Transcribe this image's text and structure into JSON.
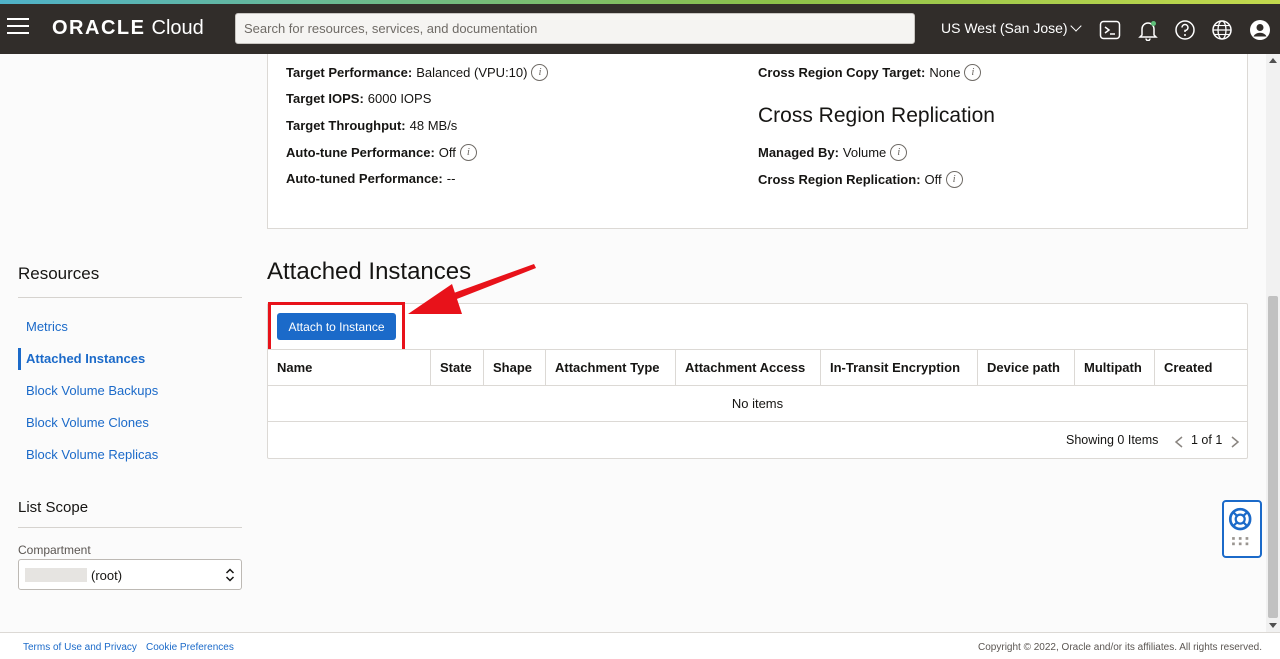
{
  "header": {
    "logo_brand": "ORACLE",
    "logo_product": "Cloud",
    "search_placeholder": "Search for resources, services, and documentation",
    "region": "US West (San Jose)",
    "icons": [
      "menu-icon",
      "cloud-shell-icon",
      "notifications-icon",
      "help-icon",
      "language-icon",
      "profile-icon"
    ]
  },
  "details": {
    "left": [
      {
        "label": "Target Performance:",
        "value": "Balanced (VPU:10)",
        "info": true
      },
      {
        "label": "Target IOPS:",
        "value": "6000 IOPS",
        "info": false
      },
      {
        "label": "Target Throughput:",
        "value": "48 MB/s",
        "info": false
      },
      {
        "label": "Auto-tune Performance:",
        "value": "Off",
        "info": true
      },
      {
        "label": "Auto-tuned Performance:",
        "value": "--",
        "info": false
      }
    ],
    "copy_target": {
      "label": "Cross Region Copy Target:",
      "value": "None"
    },
    "replication_title": "Cross Region Replication",
    "managed_by": {
      "label": "Managed By:",
      "value": "Volume"
    },
    "replication": {
      "label": "Cross Region Replication:",
      "value": "Off"
    }
  },
  "sidebar": {
    "resources_title": "Resources",
    "items": [
      {
        "label": "Metrics",
        "active": false
      },
      {
        "label": "Attached Instances",
        "active": true
      },
      {
        "label": "Block Volume Backups",
        "active": false
      },
      {
        "label": "Block Volume Clones",
        "active": false
      },
      {
        "label": "Block Volume Replicas",
        "active": false
      }
    ],
    "scope_title": "List Scope",
    "compartment_label": "Compartment",
    "compartment_value": "(root)"
  },
  "attached": {
    "title": "Attached Instances",
    "button_label": "Attach to Instance",
    "columns": [
      "Name",
      "State",
      "Shape",
      "Attachment Type",
      "Attachment Access",
      "In-Transit Encryption",
      "Device path",
      "Multipath",
      "Created"
    ],
    "empty_text": "No items",
    "showing": "Showing 0 Items",
    "page": "1 of 1"
  },
  "footer": {
    "terms": "Terms of Use and Privacy",
    "cookies": "Cookie Preferences",
    "copyright": "Copyright © 2022, Oracle and/or its affiliates. All rights reserved."
  },
  "colors": {
    "topbar": "#312d2a",
    "link": "#1b6ac9",
    "primary_button": "#1b6ac9",
    "annotation": "#e8121a"
  }
}
